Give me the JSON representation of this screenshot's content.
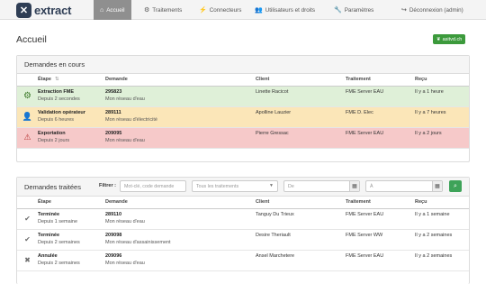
{
  "nav": {
    "logo_text": "extract",
    "items": [
      {
        "label": "Accueil",
        "icon": "home-icon",
        "glyph": "⌂"
      },
      {
        "label": "Traitements",
        "icon": "gears-icon",
        "glyph": "⚙"
      },
      {
        "label": "Connecteurs",
        "icon": "plug-icon",
        "glyph": "⚡"
      },
      {
        "label": "Utilisateurs et droits",
        "icon": "users-icon",
        "glyph": "👥"
      },
      {
        "label": "Paramètres",
        "icon": "wrench-icon",
        "glyph": "🔧"
      },
      {
        "label": "Déconnexion (admin)",
        "icon": "sign-out-icon",
        "glyph": "↪"
      }
    ]
  },
  "page_title": "Accueil",
  "badge": {
    "label": "asitvd.ch",
    "icon": "leaf-icon",
    "color": "#3c9a3c"
  },
  "current": {
    "title": "Demandes en cours",
    "headers": {
      "etape": "Étape",
      "demande": "Demande",
      "client": "Client",
      "traitement": "Traitement",
      "recu": "Reçu"
    },
    "rows": [
      {
        "status": "ok",
        "icon": "gear-icon",
        "glyph": "⚙",
        "etape": "Extraction FME",
        "duree": "Depuis 2 secondes",
        "demande": "295823",
        "reseau": "Mon réseau d'eau",
        "client": "Linette Racicot",
        "traitement": "FME Server EAU",
        "recu": "Il y a 1 heure"
      },
      {
        "status": "warn",
        "icon": "user-icon",
        "glyph": "👤",
        "etape": "Validation opérateur",
        "duree": "Depuis 6 heures",
        "demande": "289111",
        "reseau": "Mon réseau d'électricité",
        "client": "Apolline Lauzier",
        "traitement": "FME D. Elec",
        "recu": "Il y a 7 heures"
      },
      {
        "status": "err",
        "icon": "warning-icon",
        "glyph": "⚠",
        "etape": "Exportation",
        "duree": "Depuis 2 jours",
        "demande": "209095",
        "reseau": "Mon réseau d'eau",
        "client": "Pierre Gressac",
        "traitement": "FME Server EAU",
        "recu": "Il y a 2 jours"
      }
    ],
    "colors": {
      "ok": "#dff0d8",
      "warn": "#fbe6b8",
      "err": "#f6c9c9"
    }
  },
  "done": {
    "title": "Demandes traitées",
    "filter_label": "Filtrer :",
    "filter_placeholder": "Mot-clé, code demande",
    "processing_select": "Tous les traitements",
    "date_from_placeholder": "De",
    "date_to_placeholder": "À",
    "headers": {
      "etape": "Étape",
      "demande": "Demande",
      "client": "Client",
      "traitement": "Traitement",
      "recu": "Reçu"
    },
    "rows": [
      {
        "icon": "check-icon",
        "glyph": "✔",
        "etape": "Terminée",
        "duree": "Depuis 1 semaine",
        "demande": "289110",
        "reseau": "Mon réseau d'eau",
        "client": "Tanguy Du Trieux",
        "traitement": "FME Server EAU",
        "recu": "Il y a 1 semaine"
      },
      {
        "icon": "check-icon",
        "glyph": "✔",
        "etape": "Terminée",
        "duree": "Depuis 2 semaines",
        "demande": "209098",
        "reseau": "Mon réseau d'assainissement",
        "client": "Desire Theriault",
        "traitement": "FME Server WW",
        "recu": "Il y a 2 semaines"
      },
      {
        "icon": "times-icon",
        "glyph": "✖",
        "etape": "Annulée",
        "duree": "Depuis 2 semaines",
        "demande": "209096",
        "reseau": "Mon réseau d'eau",
        "client": "Ansel Marchetere",
        "traitement": "FME Server EAU",
        "recu": "Il y a 2 semaines"
      }
    ]
  }
}
